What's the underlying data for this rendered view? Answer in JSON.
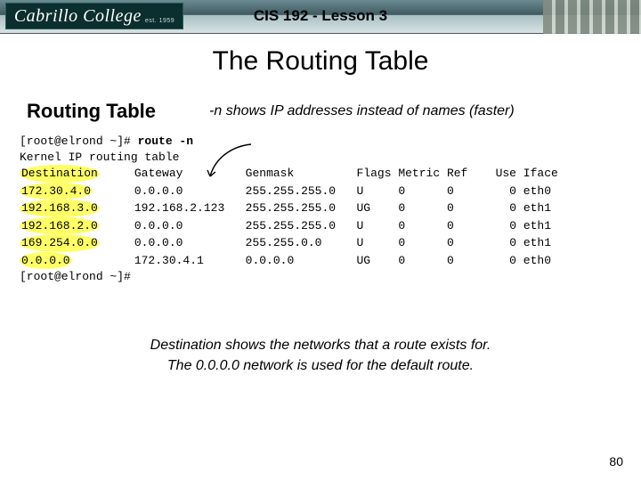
{
  "header": {
    "logo_text": "Cabrillo College",
    "est_text": "est. 1959",
    "title": "CIS 192 - Lesson 3"
  },
  "slide": {
    "title": "The Routing Table",
    "section_head": "Routing Table",
    "annotation": "-n shows IP addresses instead of names (faster)",
    "prompt1": "[root@elrond ~]# ",
    "cmd": "route -n",
    "line2": "Kernel IP routing table",
    "headers": {
      "dest": "Destination",
      "gateway": "Gateway",
      "genmask": "Genmask",
      "flags": "Flags",
      "metric": "Metric",
      "ref": "Ref",
      "use": "Use",
      "iface": "Iface"
    },
    "routes": [
      {
        "dest": "172.30.4.0",
        "gateway": "0.0.0.0",
        "genmask": "255.255.255.0",
        "flags": "U",
        "metric": "0",
        "ref": "0",
        "use": "0",
        "iface": "eth0"
      },
      {
        "dest": "192.168.3.0",
        "gateway": "192.168.2.123",
        "genmask": "255.255.255.0",
        "flags": "UG",
        "metric": "0",
        "ref": "0",
        "use": "0",
        "iface": "eth1"
      },
      {
        "dest": "192.168.2.0",
        "gateway": "0.0.0.0",
        "genmask": "255.255.255.0",
        "flags": "U",
        "metric": "0",
        "ref": "0",
        "use": "0",
        "iface": "eth1"
      },
      {
        "dest": "169.254.0.0",
        "gateway": "0.0.0.0",
        "genmask": "255.255.0.0",
        "flags": "U",
        "metric": "0",
        "ref": "0",
        "use": "0",
        "iface": "eth1"
      },
      {
        "dest": "0.0.0.0",
        "gateway": "172.30.4.1",
        "genmask": "0.0.0.0",
        "flags": "UG",
        "metric": "0",
        "ref": "0",
        "use": "0",
        "iface": "eth0"
      }
    ],
    "prompt2": "[root@elrond ~]#",
    "caption_line1": "Destination shows the networks that a route exists for.",
    "caption_line2": "The 0.0.0.0 network is used for the default route.",
    "page_number": "80"
  }
}
